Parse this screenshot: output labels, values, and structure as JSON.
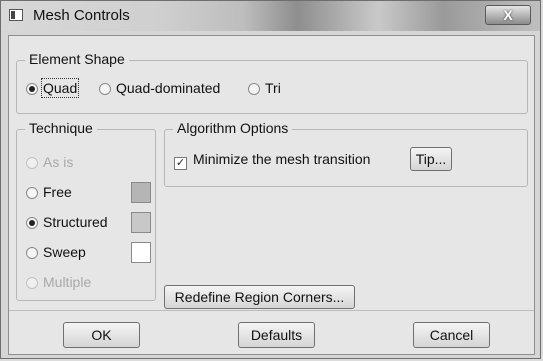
{
  "window": {
    "title": "Mesh Controls",
    "close_label": "X"
  },
  "element_shape": {
    "legend": "Element Shape",
    "options": [
      "Quad",
      "Quad-dominated",
      "Tri"
    ],
    "selected": "Quad"
  },
  "technique": {
    "legend": "Technique",
    "options": [
      "As is",
      "Free",
      "Structured",
      "Sweep",
      "Multiple"
    ],
    "selected": "Structured",
    "disabled": [
      "As is",
      "Multiple"
    ],
    "swatch_colors": {
      "free": "#b5b5b5",
      "structured": "#c8c8c8",
      "sweep": "#ffffff"
    }
  },
  "algorithm": {
    "legend": "Algorithm Options",
    "minimize_label": "Minimize the mesh transition",
    "minimize_checked": true,
    "tip_label": "Tip..."
  },
  "redefine_label": "Redefine Region Corners...",
  "footer": {
    "ok": "OK",
    "defaults": "Defaults",
    "cancel": "Cancel"
  }
}
